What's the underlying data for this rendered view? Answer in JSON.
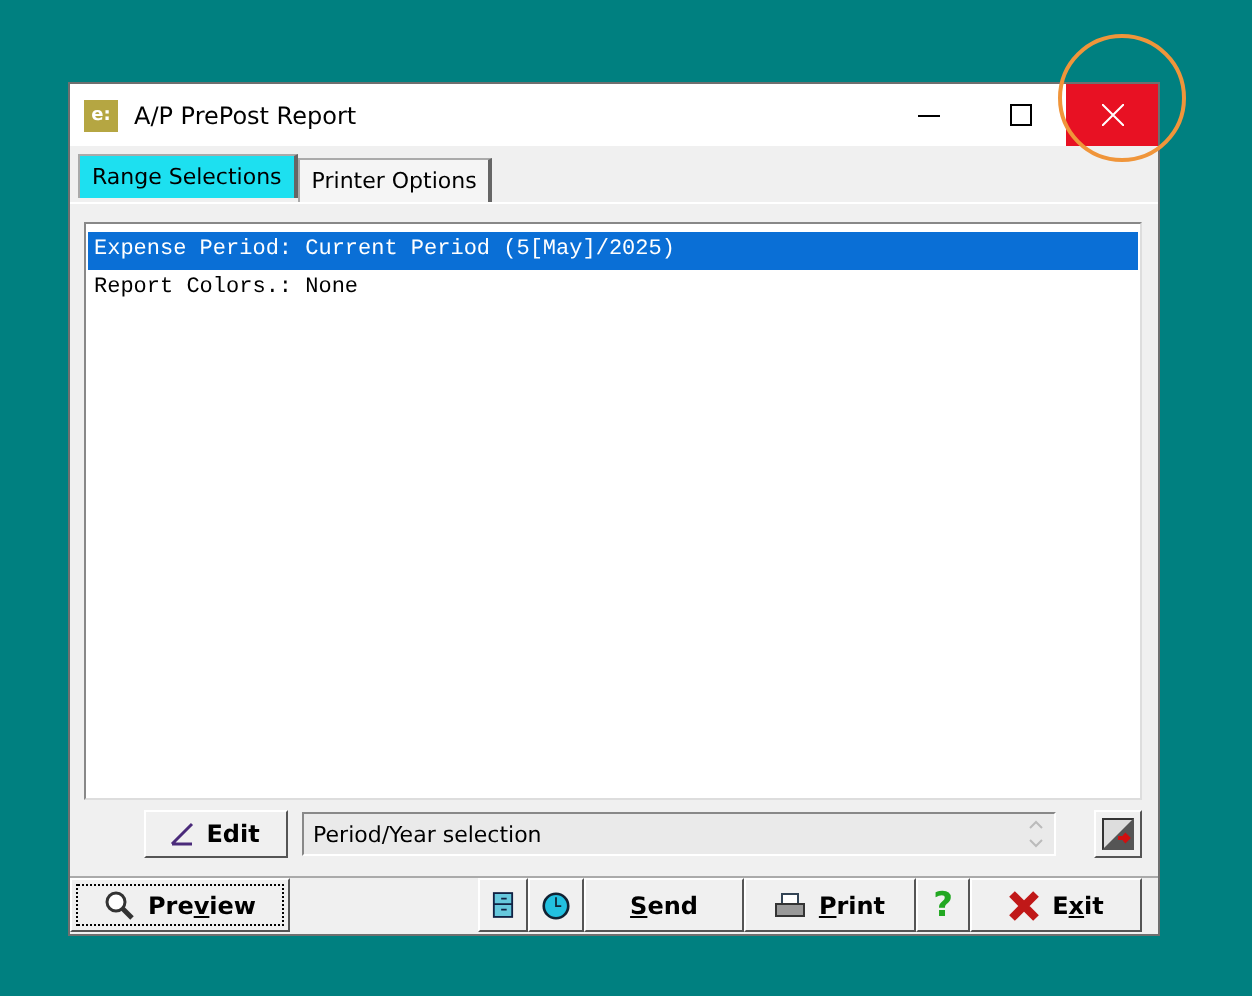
{
  "window": {
    "title": "A/P PrePost Report",
    "app_icon": "e:"
  },
  "tabs": [
    {
      "label": "Range Selections",
      "selected": true
    },
    {
      "label": "Printer Options",
      "selected": false
    }
  ],
  "list": [
    {
      "text": "Expense Period: Current Period (5[May]/2025)",
      "selected": true
    },
    {
      "text": "Report Colors.: None",
      "selected": false
    }
  ],
  "edit_button": {
    "label": "Edit"
  },
  "description": {
    "value": "Period/Year selection"
  },
  "toolbar": [
    {
      "kind": "preview",
      "pre": "Pre",
      "accel": "v",
      "post": "iew",
      "focused": true
    },
    {
      "kind": "cabinet"
    },
    {
      "kind": "clock"
    },
    {
      "kind": "send",
      "accel": "S",
      "post": "end"
    },
    {
      "kind": "print",
      "accel": "P",
      "post": "rint"
    },
    {
      "kind": "help",
      "glyph": "?"
    },
    {
      "kind": "exit",
      "pre": "E",
      "accel": "x",
      "post": "it"
    }
  ]
}
